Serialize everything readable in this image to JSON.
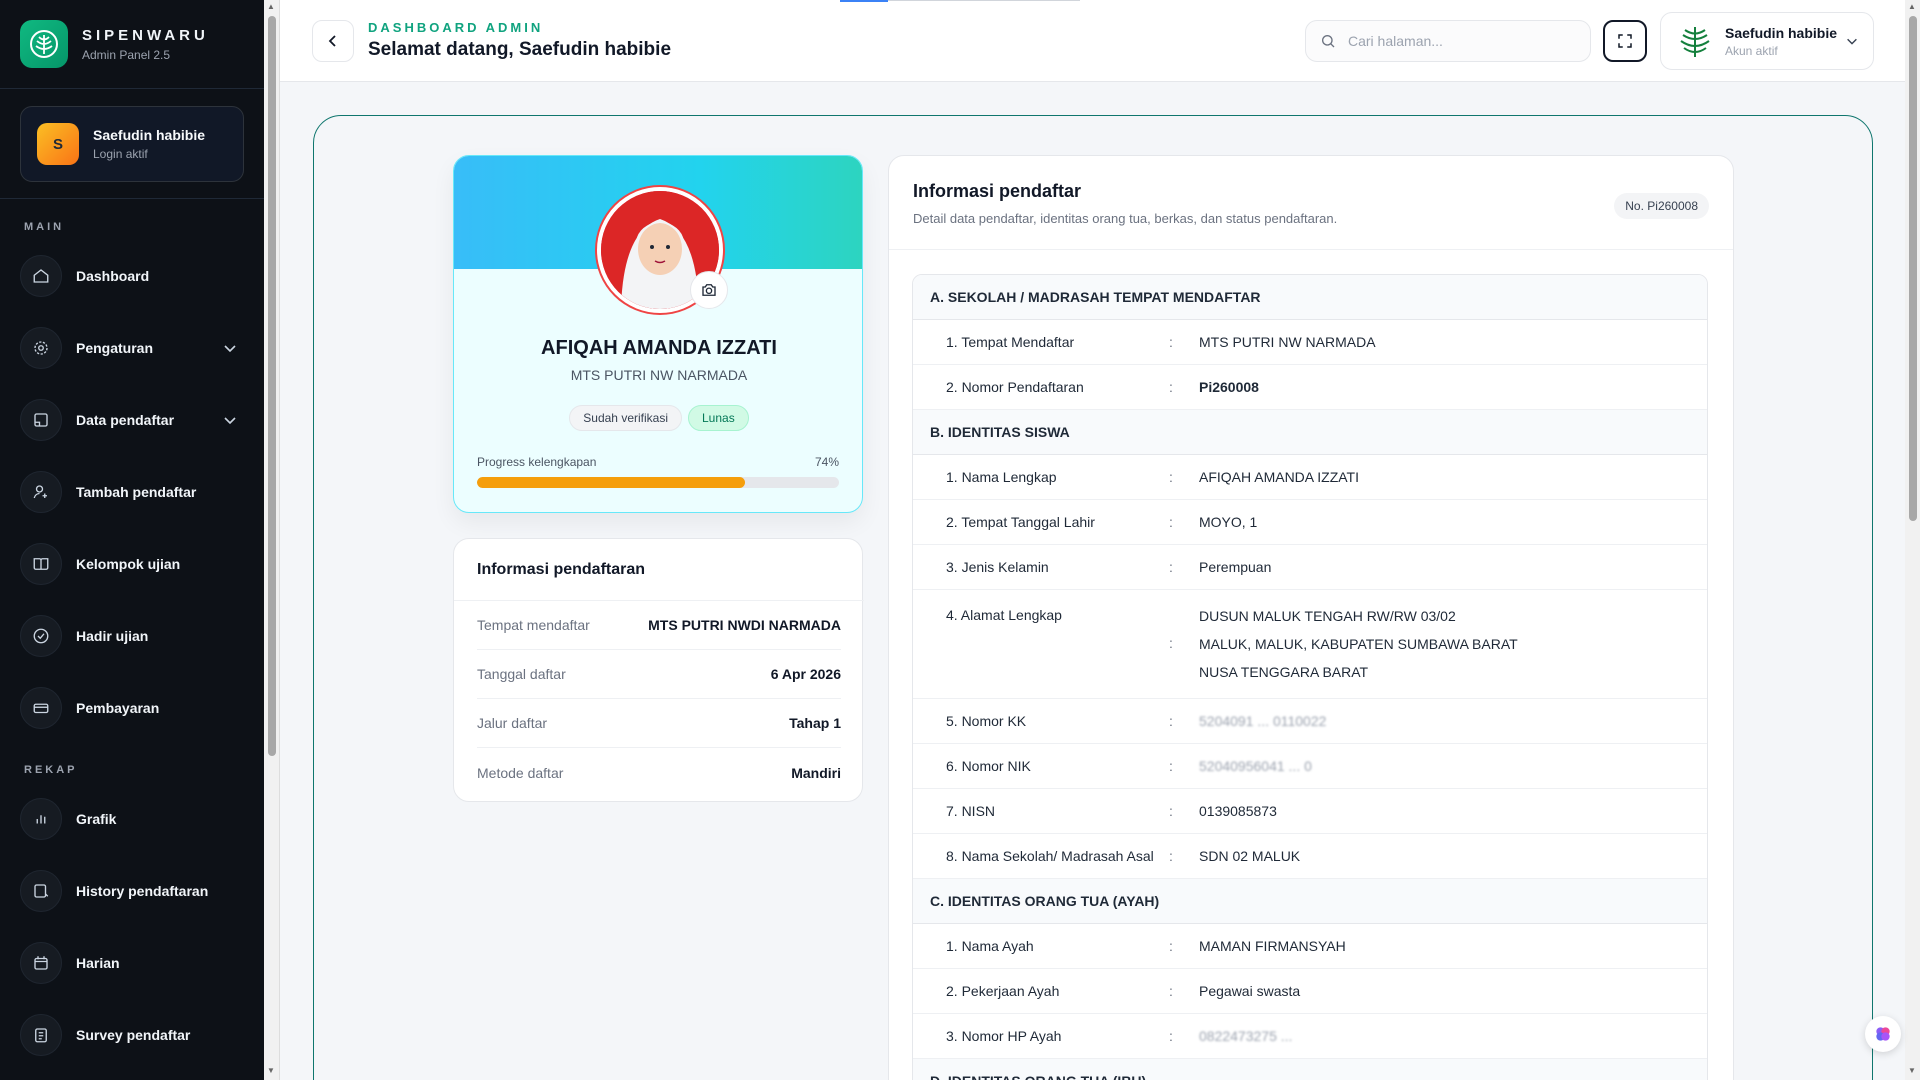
{
  "brand": {
    "name": "SIPENWARU",
    "subtitle": "Admin Panel 2.5"
  },
  "sidebar_user": {
    "initial": "S",
    "name": "Saefudin habibie",
    "status": "Login aktif"
  },
  "sections": {
    "main": "MAIN",
    "rekap": "REKAP"
  },
  "nav_main": [
    {
      "label": "Dashboard",
      "icon": "home-icon"
    },
    {
      "label": "Pengaturan",
      "icon": "settings-icon",
      "has_submenu": true
    },
    {
      "label": "Data pendaftar",
      "icon": "folder-icon",
      "has_submenu": true
    },
    {
      "label": "Tambah pendaftar",
      "icon": "user-plus-icon"
    },
    {
      "label": "Kelompok ujian",
      "icon": "book-icon"
    },
    {
      "label": "Hadir ujian",
      "icon": "check-circle-icon"
    },
    {
      "label": "Pembayaran",
      "icon": "wallet-icon"
    }
  ],
  "nav_rekap": [
    {
      "label": "Grafik",
      "icon": "bar-chart-icon"
    },
    {
      "label": "History pendaftaran",
      "icon": "history-icon"
    },
    {
      "label": "Harian",
      "icon": "calendar-icon"
    },
    {
      "label": "Survey pendaftar",
      "icon": "clipboard-icon"
    }
  ],
  "header": {
    "kicker": "DASHBOARD ADMIN",
    "title": "Selamat datang, Saefudin habibie",
    "search_placeholder": "Cari halaman...",
    "account_name": "Saefudin habibie",
    "account_status": "Akun aktif"
  },
  "profile": {
    "name": "AFIQAH AMANDA IZZATI",
    "school": "MTS PUTRI NW NARMADA",
    "badge_verified": "Sudah verifikasi",
    "badge_paid": "Lunas",
    "progress_label": "Progress kelengkapan",
    "progress_text": "74%",
    "progress_value": 0.74
  },
  "registration": {
    "title": "Informasi pendaftaran",
    "rows": [
      {
        "key": "Tempat mendaftar",
        "value": "MTS PUTRI NWDI NARMADA"
      },
      {
        "key": "Tanggal daftar",
        "value": "6 Apr 2026"
      },
      {
        "key": "Jalur daftar",
        "value": "Tahap 1"
      },
      {
        "key": "Metode daftar",
        "value": "Mandiri"
      }
    ]
  },
  "info": {
    "title": "Informasi pendaftar",
    "subtitle": "Detail data pendaftar, identitas orang tua, berkas, dan status pendaftaran.",
    "number_badge": "No. Pi260008",
    "colon": ":",
    "section_a": "A. SEKOLAH / MADRASAH TEMPAT MENDAFTAR",
    "a_rows": [
      {
        "key": "1. Tempat Mendaftar",
        "value": "MTS PUTRI NW NARMADA"
      },
      {
        "key": "2. Nomor Pendaftaran",
        "value": "Pi260008"
      }
    ],
    "section_b": "B. IDENTITAS SISWA",
    "b_rows": [
      {
        "key": "1. Nama Lengkap",
        "value": "AFIQAH AMANDA IZZATI"
      },
      {
        "key": "2. Tempat Tanggal Lahir",
        "value": "MOYO, 1"
      },
      {
        "key": "3. Jenis Kelamin",
        "value": "Perempuan"
      }
    ],
    "address": {
      "key": "4. Alamat Lengkap",
      "line1": "DUSUN MALUK TENGAH RW/RW 03/02",
      "line2": "MALUK, MALUK, KABUPATEN SUMBAWA BARAT",
      "line3": "NUSA TENGGARA BARAT"
    },
    "b_rows2": [
      {
        "key": "5. Nomor KK",
        "value": "5204091 ... 0110022"
      },
      {
        "key": "6. Nomor NIK",
        "value": "52040956041 ... 0"
      },
      {
        "key": "7. NISN",
        "value": "0139085873"
      },
      {
        "key": "8. Nama Sekolah/ Madrasah Asal",
        "value": "SDN 02 MALUK"
      }
    ],
    "section_c": "C. IDENTITAS ORANG TUA (AYAH)",
    "c_rows": [
      {
        "key": "1. Nama Ayah",
        "value": "MAMAN FIRMANSYAH"
      },
      {
        "key": "2. Pekerjaan Ayah",
        "value": "Pegawai swasta"
      },
      {
        "key": "3. Nomor HP Ayah",
        "value": "0822473275 ..."
      }
    ],
    "section_d": "D. IDENTITAS ORANG TUA (IBU)"
  }
}
